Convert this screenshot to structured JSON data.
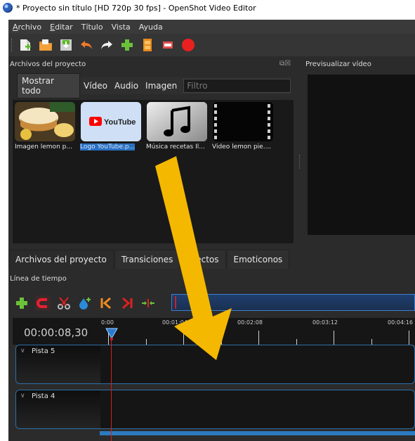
{
  "window": {
    "title": "* Proyecto sin título [HD 720p 30 fps] - OpenShot Video Editor"
  },
  "menu": [
    {
      "label": "Archivo",
      "underline": "A"
    },
    {
      "label": "Editar",
      "underline": "E"
    },
    {
      "label": "Título",
      "underline": ""
    },
    {
      "label": "Vista",
      "underline": ""
    },
    {
      "label": "Ayuda",
      "underline": ""
    }
  ],
  "toolbar_icons": [
    "new-file-icon",
    "open-folder-icon",
    "save-icon",
    "undo-icon",
    "redo-icon",
    "import-plus-icon",
    "film-strip-icon",
    "export-icon",
    "record-icon"
  ],
  "project_files": {
    "title": "Archivos del proyecto",
    "filters": [
      "Mostrar todo",
      "Vídeo",
      "Audio",
      "Imagen"
    ],
    "filter_placeholder": "Filtro",
    "items": [
      {
        "label": "Imagen lemon p...",
        "kind": "image",
        "selected": false
      },
      {
        "label": "Logo YouTube.p...",
        "kind": "youtube",
        "selected": true,
        "thumb_text": "YouTube"
      },
      {
        "label": "Música recetas Il...",
        "kind": "audio",
        "selected": false
      },
      {
        "label": "Video lemon pie....",
        "kind": "video",
        "selected": false
      }
    ]
  },
  "preview": {
    "title": "Previsualizar vídeo"
  },
  "dock_tabs": [
    "Archivos del proyecto",
    "Transiciones",
    "Efectos",
    "Emoticonos"
  ],
  "timeline": {
    "title": "Línea de tiempo",
    "current_time": "00:00:08,30",
    "ticks": [
      "0:00",
      "00:01:04",
      "00:02:08",
      "00:03:12",
      "00:04:16"
    ],
    "tracks": [
      {
        "name": "Pista 5"
      },
      {
        "name": "Pista 4"
      }
    ]
  },
  "colors": {
    "accent": "#2a70c0",
    "annotation_arrow": "#f5b800",
    "playhead": "#d02020"
  }
}
